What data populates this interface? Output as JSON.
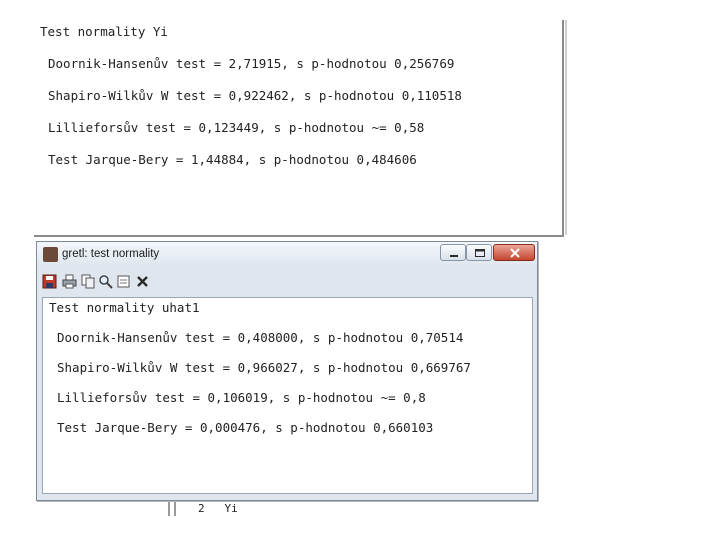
{
  "top_output": {
    "heading": "Test normality Yi",
    "lines": [
      "Doornik-Hansenův test = 2,71915, s p-hodnotou 0,256769",
      "Shapiro-Wilkův W test = 0,922462, s p-hodnotou 0,110518",
      "Lillieforsův test = 0,123449, s p-hodnotou ~= 0,58",
      "Test Jarque-Bery = 1,44884, s p-hodnotou 0,484606"
    ]
  },
  "window": {
    "title": "gretl: test normality",
    "toolbar_icons": [
      "save-icon",
      "print-icon",
      "copy-icon",
      "find-icon",
      "edit-icon",
      "close-icon"
    ],
    "output": {
      "heading": "Test normality uhat1",
      "lines": [
        "Doornik-Hansenův test = 0,408000, s p-hodnotou 0,70514",
        "Shapiro-Wilkův W test = 0,966027, s p-hodnotou 0,669767",
        "Lillieforsův test = 0,106019, s p-hodnotou ~= 0,8",
        "Test Jarque-Bery = 0,000476, s p-hodnotou 0,660103"
      ]
    }
  },
  "background": {
    "remnant_text": "2   Yi"
  },
  "colors": {
    "close_button": "#c4452f",
    "titlebar": "#dde5ee",
    "window_frame": "#dfe6ee"
  }
}
